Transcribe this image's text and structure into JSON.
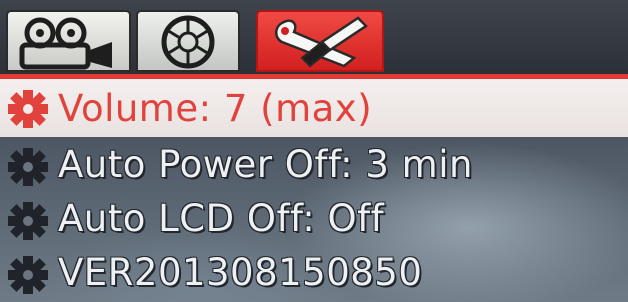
{
  "tabs": [
    {
      "icon": "video-camera-icon",
      "selected": false
    },
    {
      "icon": "camera-shutter-icon",
      "selected": false
    },
    {
      "icon": "wrench-screwdriver-icon",
      "selected": true
    }
  ],
  "menu": {
    "items": [
      {
        "label": "Volume: 7 (max)",
        "icon": "gear-icon",
        "selected": true
      },
      {
        "label": "Auto Power Off: 3 min",
        "icon": "gear-icon",
        "selected": false
      },
      {
        "label": "Auto LCD Off: Off",
        "icon": "gear-icon",
        "selected": false
      },
      {
        "label": "VER201308150850",
        "icon": "gear-icon",
        "selected": false
      }
    ]
  },
  "colors": {
    "accent": "#e2423c",
    "selected_row_bg": "#f1ebea",
    "text": "#eef1f3"
  }
}
